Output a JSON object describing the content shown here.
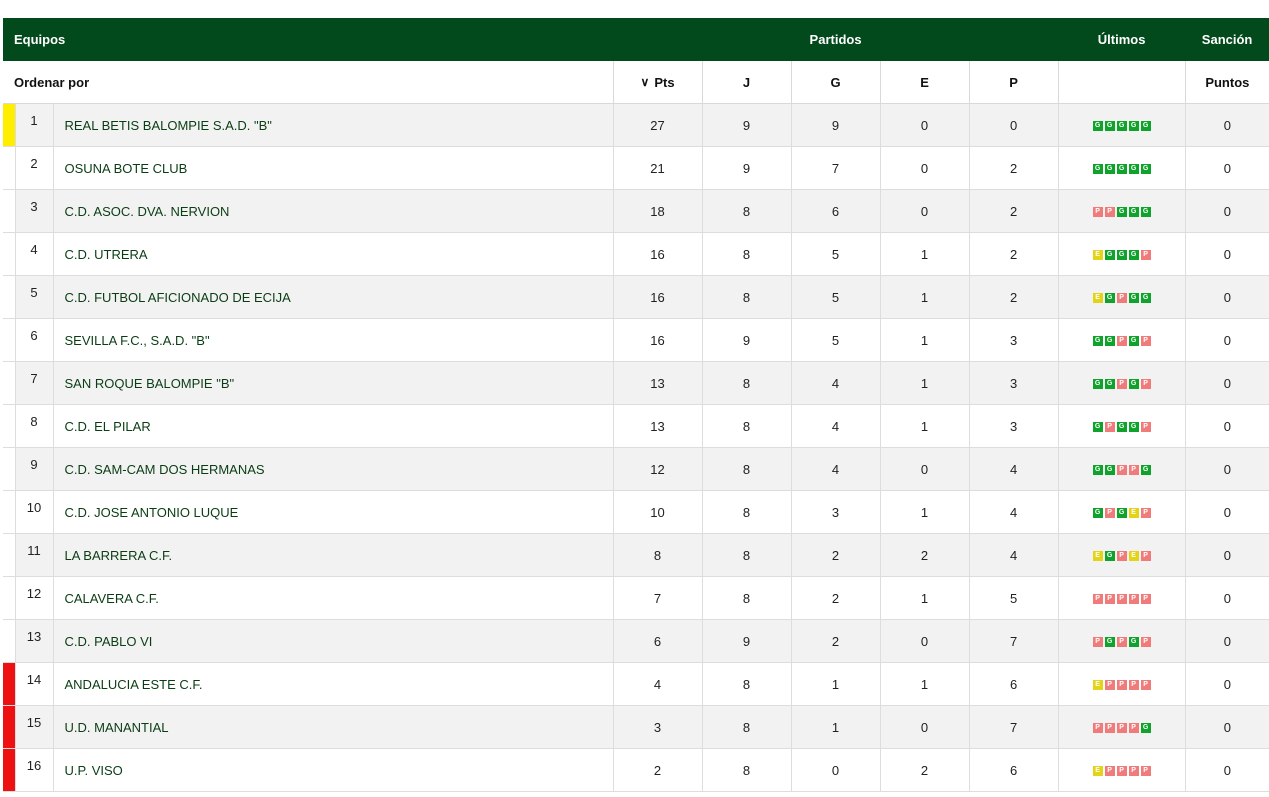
{
  "header": {
    "equipos": "Equipos",
    "partidos": "Partidos",
    "ultimos": "Últimos",
    "sancion": "Sanción"
  },
  "subheader": {
    "ordenar": "Ordenar por",
    "pts": "Pts",
    "j": "J",
    "g": "G",
    "e": "E",
    "p": "P",
    "puntos": "Puntos"
  },
  "colors": {
    "header_bg": "#02491b",
    "promo": "#ffee00",
    "releg": "#ee1111",
    "win": "#10a32c",
    "loss": "#ef7b7b",
    "draw": "#e4d418"
  },
  "rows": [
    {
      "pos": "1",
      "team": "REAL BETIS BALOMPIE S.A.D. \"B\"",
      "pts": "27",
      "j": "9",
      "g": "9",
      "e": "0",
      "p": "0",
      "last": [
        "G",
        "G",
        "G",
        "G",
        "G"
      ],
      "sancion": "0",
      "zone": "promo"
    },
    {
      "pos": "2",
      "team": "OSUNA BOTE CLUB",
      "pts": "21",
      "j": "9",
      "g": "7",
      "e": "0",
      "p": "2",
      "last": [
        "G",
        "G",
        "G",
        "G",
        "G"
      ],
      "sancion": "0",
      "zone": ""
    },
    {
      "pos": "3",
      "team": "C.D. ASOC. DVA. NERVION",
      "pts": "18",
      "j": "8",
      "g": "6",
      "e": "0",
      "p": "2",
      "last": [
        "P",
        "P",
        "G",
        "G",
        "G"
      ],
      "sancion": "0",
      "zone": ""
    },
    {
      "pos": "4",
      "team": "C.D. UTRERA",
      "pts": "16",
      "j": "8",
      "g": "5",
      "e": "1",
      "p": "2",
      "last": [
        "E",
        "G",
        "G",
        "G",
        "P"
      ],
      "sancion": "0",
      "zone": ""
    },
    {
      "pos": "5",
      "team": "C.D. FUTBOL AFICIONADO DE ECIJA",
      "pts": "16",
      "j": "8",
      "g": "5",
      "e": "1",
      "p": "2",
      "last": [
        "E",
        "G",
        "P",
        "G",
        "G"
      ],
      "sancion": "0",
      "zone": ""
    },
    {
      "pos": "6",
      "team": "SEVILLA F.C., S.A.D. \"B\"",
      "pts": "16",
      "j": "9",
      "g": "5",
      "e": "1",
      "p": "3",
      "last": [
        "G",
        "G",
        "P",
        "G",
        "P"
      ],
      "sancion": "0",
      "zone": ""
    },
    {
      "pos": "7",
      "team": "SAN ROQUE BALOMPIE \"B\"",
      "pts": "13",
      "j": "8",
      "g": "4",
      "e": "1",
      "p": "3",
      "last": [
        "G",
        "G",
        "P",
        "G",
        "P"
      ],
      "sancion": "0",
      "zone": ""
    },
    {
      "pos": "8",
      "team": "C.D. EL PILAR",
      "pts": "13",
      "j": "8",
      "g": "4",
      "e": "1",
      "p": "3",
      "last": [
        "G",
        "P",
        "G",
        "G",
        "P"
      ],
      "sancion": "0",
      "zone": ""
    },
    {
      "pos": "9",
      "team": "C.D. SAM-CAM DOS HERMANAS",
      "pts": "12",
      "j": "8",
      "g": "4",
      "e": "0",
      "p": "4",
      "last": [
        "G",
        "G",
        "P",
        "P",
        "G"
      ],
      "sancion": "0",
      "zone": ""
    },
    {
      "pos": "10",
      "team": "C.D. JOSE ANTONIO LUQUE",
      "pts": "10",
      "j": "8",
      "g": "3",
      "e": "1",
      "p": "4",
      "last": [
        "G",
        "P",
        "G",
        "E",
        "P"
      ],
      "sancion": "0",
      "zone": ""
    },
    {
      "pos": "11",
      "team": "LA BARRERA C.F.",
      "pts": "8",
      "j": "8",
      "g": "2",
      "e": "2",
      "p": "4",
      "last": [
        "E",
        "G",
        "P",
        "E",
        "P"
      ],
      "sancion": "0",
      "zone": ""
    },
    {
      "pos": "12",
      "team": "CALAVERA C.F.",
      "pts": "7",
      "j": "8",
      "g": "2",
      "e": "1",
      "p": "5",
      "last": [
        "P",
        "P",
        "P",
        "P",
        "P"
      ],
      "sancion": "0",
      "zone": ""
    },
    {
      "pos": "13",
      "team": "C.D. PABLO VI",
      "pts": "6",
      "j": "9",
      "g": "2",
      "e": "0",
      "p": "7",
      "last": [
        "P",
        "G",
        "P",
        "G",
        "P"
      ],
      "sancion": "0",
      "zone": ""
    },
    {
      "pos": "14",
      "team": "ANDALUCIA ESTE C.F.",
      "pts": "4",
      "j": "8",
      "g": "1",
      "e": "1",
      "p": "6",
      "last": [
        "E",
        "P",
        "P",
        "P",
        "P"
      ],
      "sancion": "0",
      "zone": "releg"
    },
    {
      "pos": "15",
      "team": "U.D. MANANTIAL",
      "pts": "3",
      "j": "8",
      "g": "1",
      "e": "0",
      "p": "7",
      "last": [
        "P",
        "P",
        "P",
        "P",
        "G"
      ],
      "sancion": "0",
      "zone": "releg"
    },
    {
      "pos": "16",
      "team": "U.P. VISO",
      "pts": "2",
      "j": "8",
      "g": "0",
      "e": "2",
      "p": "6",
      "last": [
        "E",
        "P",
        "P",
        "P",
        "P"
      ],
      "sancion": "0",
      "zone": "releg"
    }
  ]
}
